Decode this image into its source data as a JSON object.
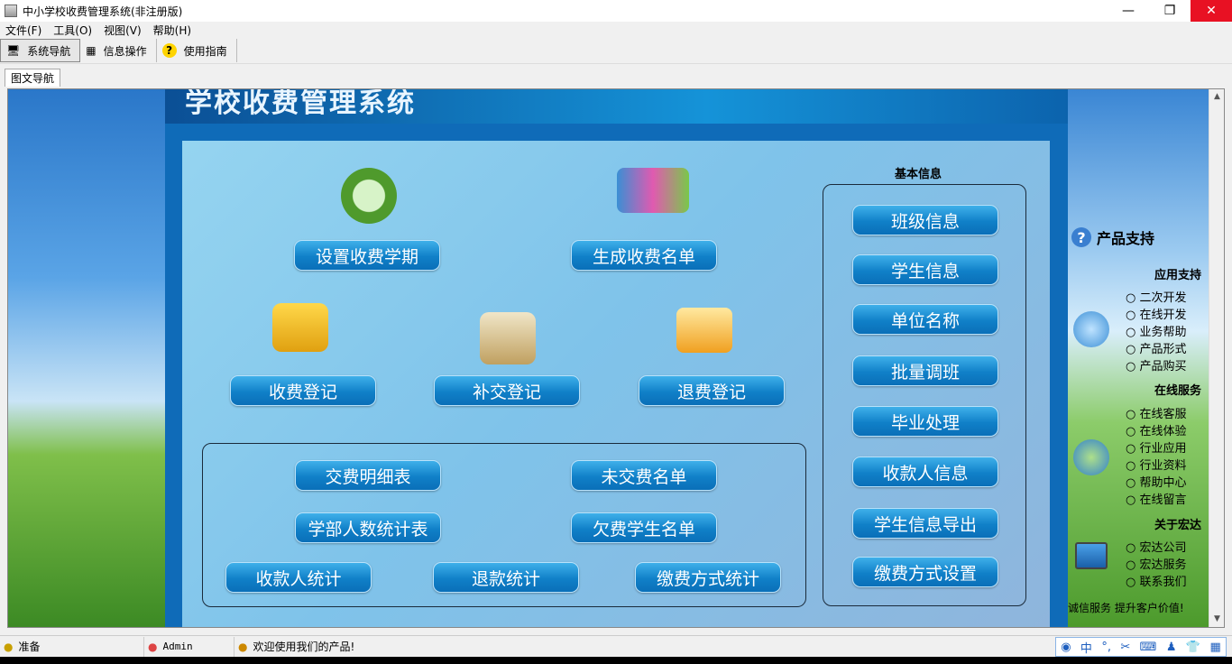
{
  "window": {
    "title": "中小学校收费管理系统(非注册版)"
  },
  "menu": [
    "文件(F)",
    "工具(O)",
    "视图(V)",
    "帮助(H)"
  ],
  "toolbar": {
    "nav": "系统导航",
    "info": "信息操作",
    "guide": "使用指南"
  },
  "tab": "图文导航",
  "banner": "学校收费管理系统",
  "buttons": {
    "set_term": "设置收费学期",
    "gen_list": "生成收费名单",
    "register": "收费登记",
    "makeup": "补交登记",
    "refund": "退费登记",
    "detail": "交费明细表",
    "unpaid": "未交费名单",
    "dept_count": "学部人数统计表",
    "owe": "欠费学生名单",
    "payee_stat": "收款人统计",
    "refund_stat": "退款统计",
    "method_stat": "缴费方式统计"
  },
  "basic": {
    "title": "基本信息",
    "items": [
      "班级信息",
      "学生信息",
      "单位名称",
      "批量调班",
      "毕业处理",
      "收款人信息",
      "学生信息导出",
      "缴费方式设置"
    ]
  },
  "side": {
    "support_title": "产品支持",
    "app_support": "应用支持",
    "app_items": [
      "二次开发",
      "在线开发",
      "业务帮助",
      "产品形式",
      "产品购买"
    ],
    "online": "在线服务",
    "online_items": [
      "在线客服",
      "在线体验",
      "行业应用",
      "行业资料",
      "帮助中心",
      "在线留言"
    ],
    "about": "关于宏达",
    "about_items": [
      "宏达公司",
      "宏达服务",
      "联系我们"
    ],
    "slogan": "诚信服务  提升客户价值!"
  },
  "status": {
    "ready": "准备",
    "user": "Admin",
    "welcome": "欢迎使用我们的产品!",
    "ime": "中"
  }
}
